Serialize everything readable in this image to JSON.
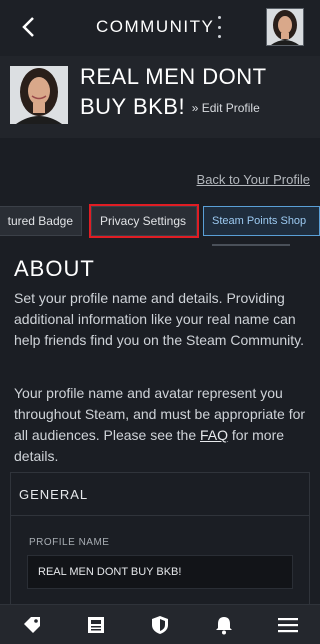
{
  "header": {
    "title": "COMMUNITY",
    "back_icon": "chevron-left-icon",
    "menu_icon": "kebab-menu-icon"
  },
  "profile": {
    "name": "REAL MEN DONT BUY BKB!",
    "edit_link": "» Edit Profile"
  },
  "main": {
    "back_to_profile": "Back to Your Profile",
    "tabs": [
      {
        "label": "tured Badge"
      },
      {
        "label": "Privacy Settings",
        "highlighted": true
      },
      {
        "label": "Steam Points Shop"
      }
    ],
    "about": {
      "title": "ABOUT",
      "paragraph1": "Set your profile name and details. Providing additional information like your real name can help friends find you on the Steam Community.",
      "paragraph2_pre": "Your profile name and avatar represent you throughout Steam, and must be appropriate for all audiences. Please see the ",
      "faq_link": "FAQ",
      "paragraph2_post": " for more details."
    },
    "general": {
      "title": "GENERAL",
      "profile_name_label": "PROFILE NAME",
      "profile_name_value": "REAL MEN DONT BUY BKB!"
    }
  },
  "bottom_nav": [
    {
      "icon": "tag-icon"
    },
    {
      "icon": "news-icon"
    },
    {
      "icon": "shield-icon"
    },
    {
      "icon": "bell-icon"
    },
    {
      "icon": "hamburger-menu-icon"
    }
  ],
  "colors": {
    "background": "#1b1e24",
    "highlight": "#e01d24",
    "accent_blue": "#5a9fd6"
  }
}
